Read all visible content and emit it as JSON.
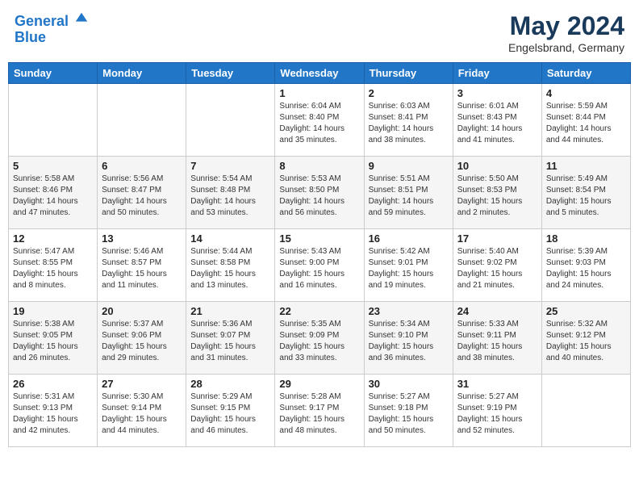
{
  "header": {
    "logo_line1": "General",
    "logo_line2": "Blue",
    "title": "May 2024",
    "subtitle": "Engelsbrand, Germany"
  },
  "days_of_week": [
    "Sunday",
    "Monday",
    "Tuesday",
    "Wednesday",
    "Thursday",
    "Friday",
    "Saturday"
  ],
  "weeks": [
    [
      {
        "day": "",
        "info": ""
      },
      {
        "day": "",
        "info": ""
      },
      {
        "day": "",
        "info": ""
      },
      {
        "day": "1",
        "info": "Sunrise: 6:04 AM\nSunset: 8:40 PM\nDaylight: 14 hours\nand 35 minutes."
      },
      {
        "day": "2",
        "info": "Sunrise: 6:03 AM\nSunset: 8:41 PM\nDaylight: 14 hours\nand 38 minutes."
      },
      {
        "day": "3",
        "info": "Sunrise: 6:01 AM\nSunset: 8:43 PM\nDaylight: 14 hours\nand 41 minutes."
      },
      {
        "day": "4",
        "info": "Sunrise: 5:59 AM\nSunset: 8:44 PM\nDaylight: 14 hours\nand 44 minutes."
      }
    ],
    [
      {
        "day": "5",
        "info": "Sunrise: 5:58 AM\nSunset: 8:46 PM\nDaylight: 14 hours\nand 47 minutes."
      },
      {
        "day": "6",
        "info": "Sunrise: 5:56 AM\nSunset: 8:47 PM\nDaylight: 14 hours\nand 50 minutes."
      },
      {
        "day": "7",
        "info": "Sunrise: 5:54 AM\nSunset: 8:48 PM\nDaylight: 14 hours\nand 53 minutes."
      },
      {
        "day": "8",
        "info": "Sunrise: 5:53 AM\nSunset: 8:50 PM\nDaylight: 14 hours\nand 56 minutes."
      },
      {
        "day": "9",
        "info": "Sunrise: 5:51 AM\nSunset: 8:51 PM\nDaylight: 14 hours\nand 59 minutes."
      },
      {
        "day": "10",
        "info": "Sunrise: 5:50 AM\nSunset: 8:53 PM\nDaylight: 15 hours\nand 2 minutes."
      },
      {
        "day": "11",
        "info": "Sunrise: 5:49 AM\nSunset: 8:54 PM\nDaylight: 15 hours\nand 5 minutes."
      }
    ],
    [
      {
        "day": "12",
        "info": "Sunrise: 5:47 AM\nSunset: 8:55 PM\nDaylight: 15 hours\nand 8 minutes."
      },
      {
        "day": "13",
        "info": "Sunrise: 5:46 AM\nSunset: 8:57 PM\nDaylight: 15 hours\nand 11 minutes."
      },
      {
        "day": "14",
        "info": "Sunrise: 5:44 AM\nSunset: 8:58 PM\nDaylight: 15 hours\nand 13 minutes."
      },
      {
        "day": "15",
        "info": "Sunrise: 5:43 AM\nSunset: 9:00 PM\nDaylight: 15 hours\nand 16 minutes."
      },
      {
        "day": "16",
        "info": "Sunrise: 5:42 AM\nSunset: 9:01 PM\nDaylight: 15 hours\nand 19 minutes."
      },
      {
        "day": "17",
        "info": "Sunrise: 5:40 AM\nSunset: 9:02 PM\nDaylight: 15 hours\nand 21 minutes."
      },
      {
        "day": "18",
        "info": "Sunrise: 5:39 AM\nSunset: 9:03 PM\nDaylight: 15 hours\nand 24 minutes."
      }
    ],
    [
      {
        "day": "19",
        "info": "Sunrise: 5:38 AM\nSunset: 9:05 PM\nDaylight: 15 hours\nand 26 minutes."
      },
      {
        "day": "20",
        "info": "Sunrise: 5:37 AM\nSunset: 9:06 PM\nDaylight: 15 hours\nand 29 minutes."
      },
      {
        "day": "21",
        "info": "Sunrise: 5:36 AM\nSunset: 9:07 PM\nDaylight: 15 hours\nand 31 minutes."
      },
      {
        "day": "22",
        "info": "Sunrise: 5:35 AM\nSunset: 9:09 PM\nDaylight: 15 hours\nand 33 minutes."
      },
      {
        "day": "23",
        "info": "Sunrise: 5:34 AM\nSunset: 9:10 PM\nDaylight: 15 hours\nand 36 minutes."
      },
      {
        "day": "24",
        "info": "Sunrise: 5:33 AM\nSunset: 9:11 PM\nDaylight: 15 hours\nand 38 minutes."
      },
      {
        "day": "25",
        "info": "Sunrise: 5:32 AM\nSunset: 9:12 PM\nDaylight: 15 hours\nand 40 minutes."
      }
    ],
    [
      {
        "day": "26",
        "info": "Sunrise: 5:31 AM\nSunset: 9:13 PM\nDaylight: 15 hours\nand 42 minutes."
      },
      {
        "day": "27",
        "info": "Sunrise: 5:30 AM\nSunset: 9:14 PM\nDaylight: 15 hours\nand 44 minutes."
      },
      {
        "day": "28",
        "info": "Sunrise: 5:29 AM\nSunset: 9:15 PM\nDaylight: 15 hours\nand 46 minutes."
      },
      {
        "day": "29",
        "info": "Sunrise: 5:28 AM\nSunset: 9:17 PM\nDaylight: 15 hours\nand 48 minutes."
      },
      {
        "day": "30",
        "info": "Sunrise: 5:27 AM\nSunset: 9:18 PM\nDaylight: 15 hours\nand 50 minutes."
      },
      {
        "day": "31",
        "info": "Sunrise: 5:27 AM\nSunset: 9:19 PM\nDaylight: 15 hours\nand 52 minutes."
      },
      {
        "day": "",
        "info": ""
      }
    ]
  ]
}
